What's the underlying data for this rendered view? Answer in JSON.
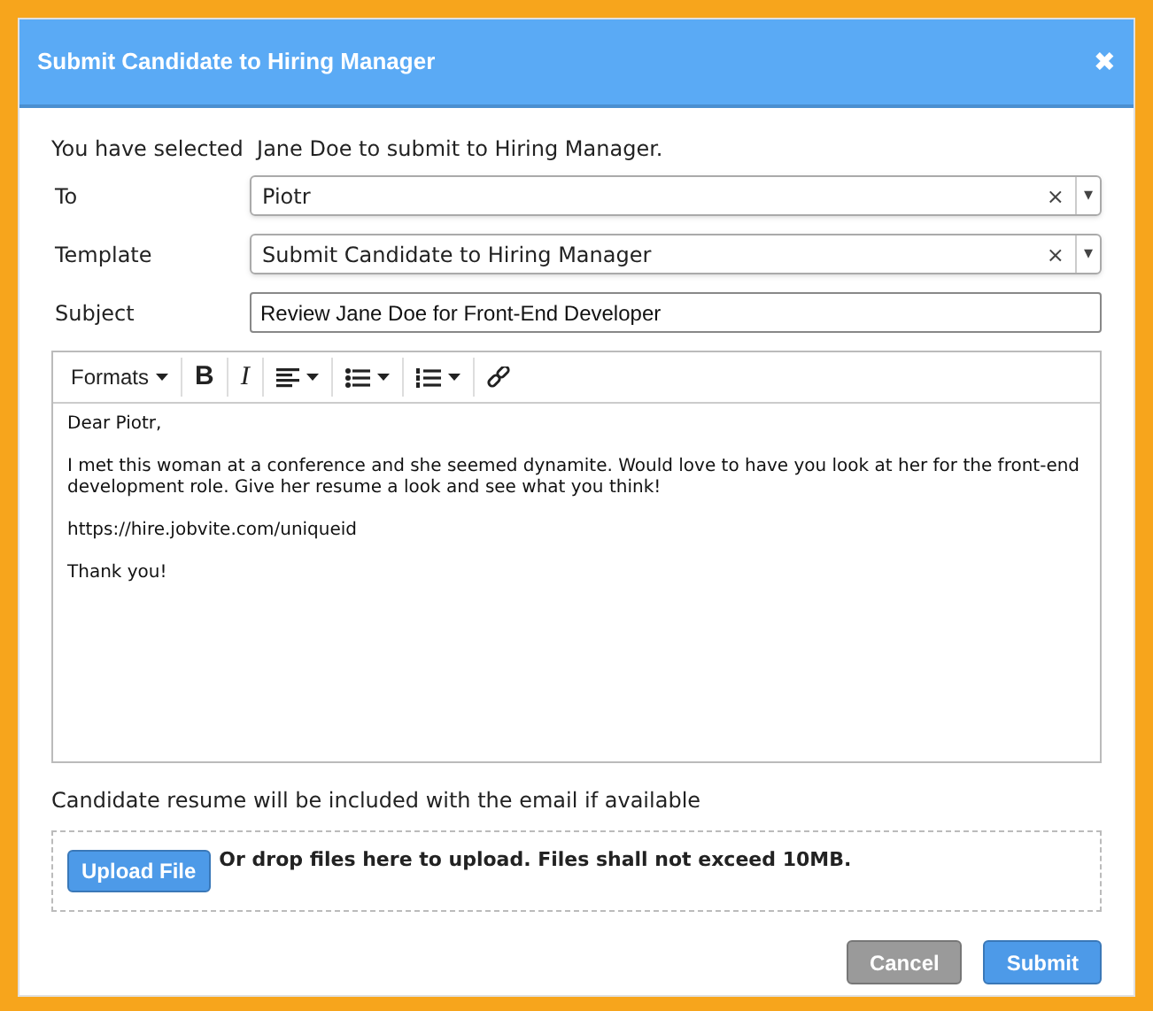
{
  "dialog": {
    "title": "Submit Candidate to Hiring Manager",
    "close": "✖"
  },
  "intro": "You have selected  Jane Doe to submit to Hiring Manager.",
  "fields": [
    {
      "label": "To",
      "kind": "select",
      "value": "Piotr",
      "clear": "×",
      "caret": "▾"
    },
    {
      "label": "Template",
      "kind": "select",
      "value": "Submit Candidate to Hiring Manager",
      "clear": "×",
      "caret": "▾"
    },
    {
      "label": "Subject",
      "kind": "text",
      "value": "Review Jane Doe for Front-End Developer"
    }
  ],
  "editor": {
    "toolbar": [
      {
        "kind": "formats",
        "label": "Formats"
      },
      {
        "kind": "bold",
        "label": "B"
      },
      {
        "kind": "italic",
        "label": "I"
      },
      {
        "kind": "align"
      },
      {
        "kind": "bullets"
      },
      {
        "kind": "numbers"
      },
      {
        "kind": "link"
      }
    ],
    "paragraphs": [
      "Dear Piotr,",
      "I met this woman at a conference and she seemed dynamite. Would love to have you look at her for the front-end development role. Give her resume a look and see what you think!",
      "https://hire.jobvite.com/uniqueid",
      "Thank you!"
    ]
  },
  "note": "Candidate resume will be included with the email if available",
  "upload": {
    "button": "Upload File",
    "hint": "Or drop files here to upload. Files shall not exceed 10MB."
  },
  "buttons": [
    {
      "label": "Cancel",
      "kind": "secondary"
    },
    {
      "label": "Submit",
      "kind": "primary"
    }
  ]
}
